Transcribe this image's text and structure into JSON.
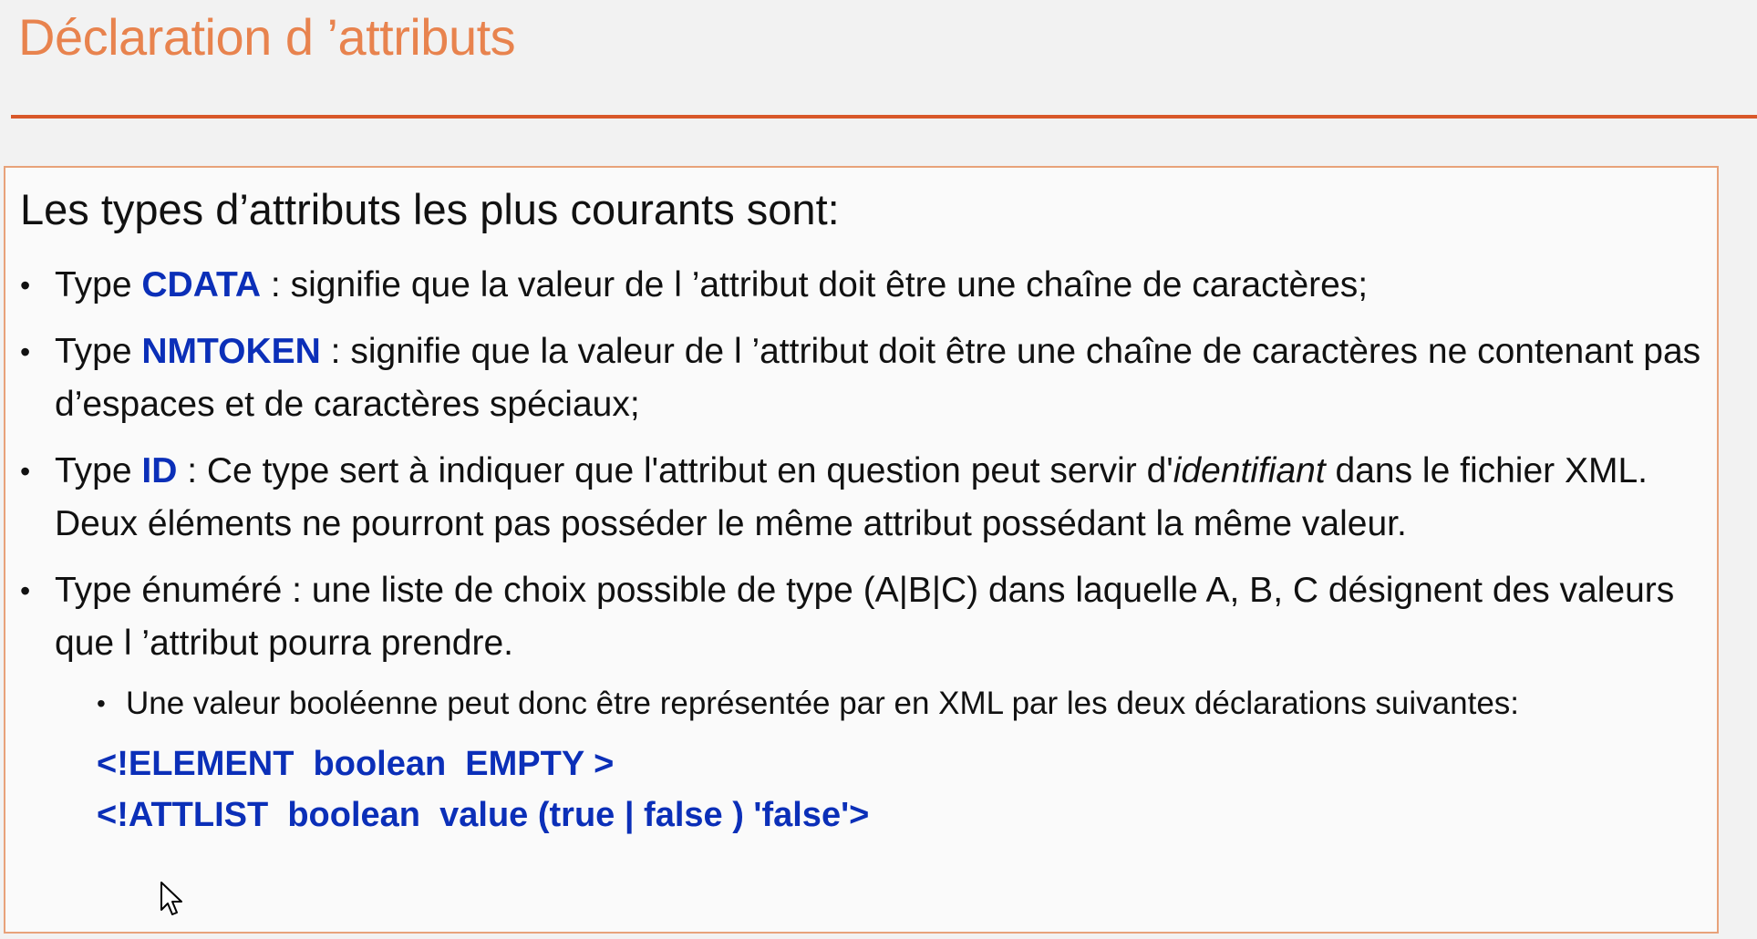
{
  "slide": {
    "title": "Déclaration d ’attributs"
  },
  "content": {
    "heading": "Les types d’attributs les plus courants sont:",
    "bullets": [
      {
        "prefix": "Type ",
        "keyword": "CDATA",
        "text": " : signifie que la valeur de l ’attribut  doit être une chaîne de caractères;"
      },
      {
        "prefix": "Type ",
        "keyword": "NMTOKEN",
        "text": " : signifie que la valeur de l ’attribut  doit être une chaîne de caractères ne contenant pas d’espaces et de caractères spéciaux;"
      },
      {
        "prefix": "Type ",
        "keyword": "ID",
        "text_before": " : Ce type sert à indiquer que l'attribut en question peut servir d'",
        "emphasis": "identifiant",
        "text_after": " dans le fichier XML. Deux éléments ne pourront pas posséder le même attribut possédant la même valeur."
      },
      {
        "text": "Type énuméré : une liste de choix possible de type (A|B|C) dans laquelle  A, B, C désignent des valeurs que l ’attribut pourra prendre."
      }
    ],
    "sub_bullet": "Une valeur booléenne peut donc être représentée par en XML par les deux déclarations suivantes:",
    "code_lines": [
      "<!ELEMENT  boolean  EMPTY >",
      "<!ATTLIST  boolean  value (true | false ) 'false'>"
    ]
  },
  "colors": {
    "title": "#e8834e",
    "rule": "#d9582a",
    "box_border": "#e8a27a",
    "keyword": "#0b2fb8"
  },
  "icons": {
    "cursor": "mouse-pointer-icon"
  }
}
